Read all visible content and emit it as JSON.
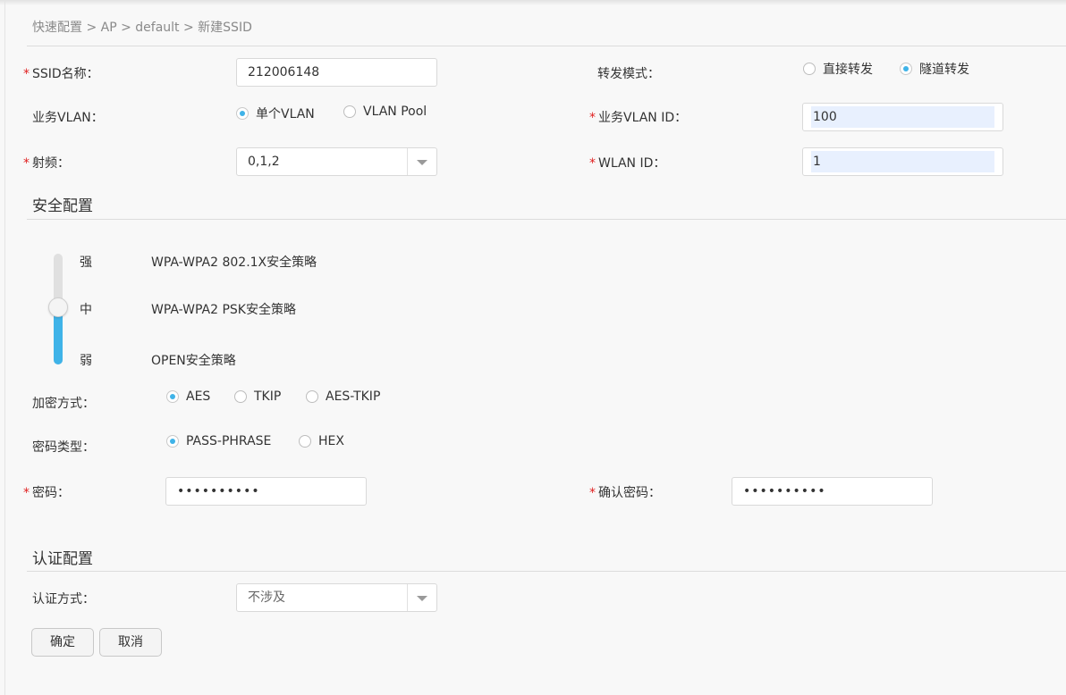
{
  "breadcrumb": "快速配置 > AP > default > 新建SSID",
  "form": {
    "required_mark": "*",
    "ssid_name": {
      "label": "SSID名称：",
      "value": "212006148"
    },
    "forward_mode": {
      "label": "转发模式：",
      "options": [
        "直接转发",
        "隧道转发"
      ],
      "selected": "隧道转发"
    },
    "service_vlan": {
      "label": "业务VLAN：",
      "options": [
        "单个VLAN",
        "VLAN Pool"
      ],
      "selected": "单个VLAN"
    },
    "service_vlan_id": {
      "label": "业务VLAN ID：",
      "value": "100"
    },
    "radio_freq": {
      "label": "射频：",
      "value": "0,1,2"
    },
    "wlan_id": {
      "label": "WLAN ID：",
      "value": "1"
    }
  },
  "security": {
    "title": "安全配置",
    "levels": [
      {
        "level": "强",
        "policy": "WPA-WPA2 802.1X安全策略"
      },
      {
        "level": "中",
        "policy": "WPA-WPA2 PSK安全策略"
      },
      {
        "level": "弱",
        "policy": "OPEN安全策略"
      }
    ],
    "selected_level": "中",
    "encryption": {
      "label": "加密方式：",
      "options": [
        "AES",
        "TKIP",
        "AES-TKIP"
      ],
      "selected": "AES"
    },
    "key_type": {
      "label": "密码类型：",
      "options": [
        "PASS-PHRASE",
        "HEX"
      ],
      "selected": "PASS-PHRASE"
    },
    "password": {
      "label": "密码：",
      "value": "••••••••••"
    },
    "confirm_password": {
      "label": "确认密码：",
      "value": "••••••••••"
    }
  },
  "auth": {
    "title": "认证配置",
    "method": {
      "label": "认证方式：",
      "value": "不涉及"
    }
  },
  "buttons": {
    "ok": "确定",
    "cancel": "取消"
  },
  "colors": {
    "accent": "#3fb3e8",
    "required": "#e02020",
    "autofill": "#e8f0fe"
  }
}
